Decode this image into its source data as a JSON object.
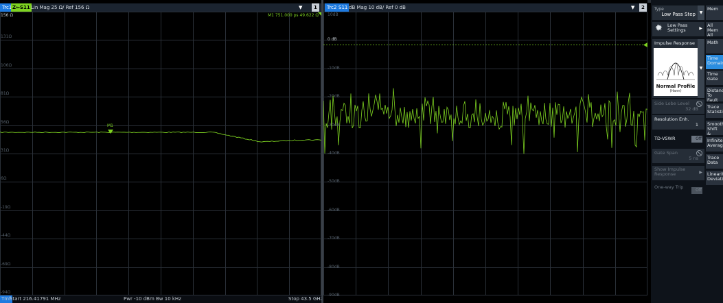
{
  "diagram1": {
    "trace_label": "Trc1",
    "measurement": "Z⇐S11",
    "format": "Lin Mag  25 Ω/ Ref 156 Ω",
    "number": "1",
    "ref_value": "156 Ω",
    "marker_readout": "M1 751.000  ps 49.622  Ω",
    "marker_label": "M1",
    "y_labels": [
      "131Ω",
      "106Ω",
      "81Ω",
      "56Ω",
      "31Ω",
      "6Ω",
      "-19Ω",
      "-44Ω",
      "-69Ω",
      "-94Ω"
    ],
    "footer": {
      "marker": "Tmf",
      "start": "Start  216.41791 MHz",
      "pwr": "Pwr  -10 dBm   Bw  10 kHz",
      "stop": "Stop  43.5 GHz"
    }
  },
  "diagram2": {
    "trace_label": "Trc2",
    "measurement": "S11",
    "format": "dB Mag  10 dB/ Ref 0 dB",
    "number": "2",
    "ref_label": "0 dB",
    "y_labels": [
      "10dB",
      "0 dB",
      "-10dB",
      "-20dB",
      "-30dB",
      "-40dB",
      "-50dB",
      "-60dB",
      "-70dB",
      "-80dB",
      "-90dB"
    ]
  },
  "panel": {
    "type_label": "Type",
    "type_value": "Low Pass Step",
    "low_pass_settings": "Low Pass Settings",
    "impulse_response": "Impulse Response",
    "profile_name": "Normal Profile",
    "profile_sub": "(Hann)",
    "side_lobe_label": "Side Lobe Level",
    "side_lobe_value": "32 dB",
    "resolution_label": "Resolution Enh.",
    "resolution_value": "1",
    "tdvswr_label": "TD-VSWR",
    "tdvswr_state": "Off",
    "gate_span_label": "Gate Span",
    "gate_span_value": "5 ns",
    "show_impulse_label": "Show Impulse Response",
    "one_way_label": "One-way Trip",
    "one_way_state": "Off"
  },
  "softkeys": [
    "Mem",
    "All Mem All Data",
    "Math",
    "Time Domain",
    "Time Gate",
    "Distance To Fault",
    "Trace Statistics",
    "Smooth Shift &",
    "Infinite Averag",
    "Trace Data",
    "Linearit Deviati"
  ],
  "colors": {
    "trace": "#7ed321",
    "accent": "#1d7ae0",
    "ref_line": "#7ed321"
  }
}
